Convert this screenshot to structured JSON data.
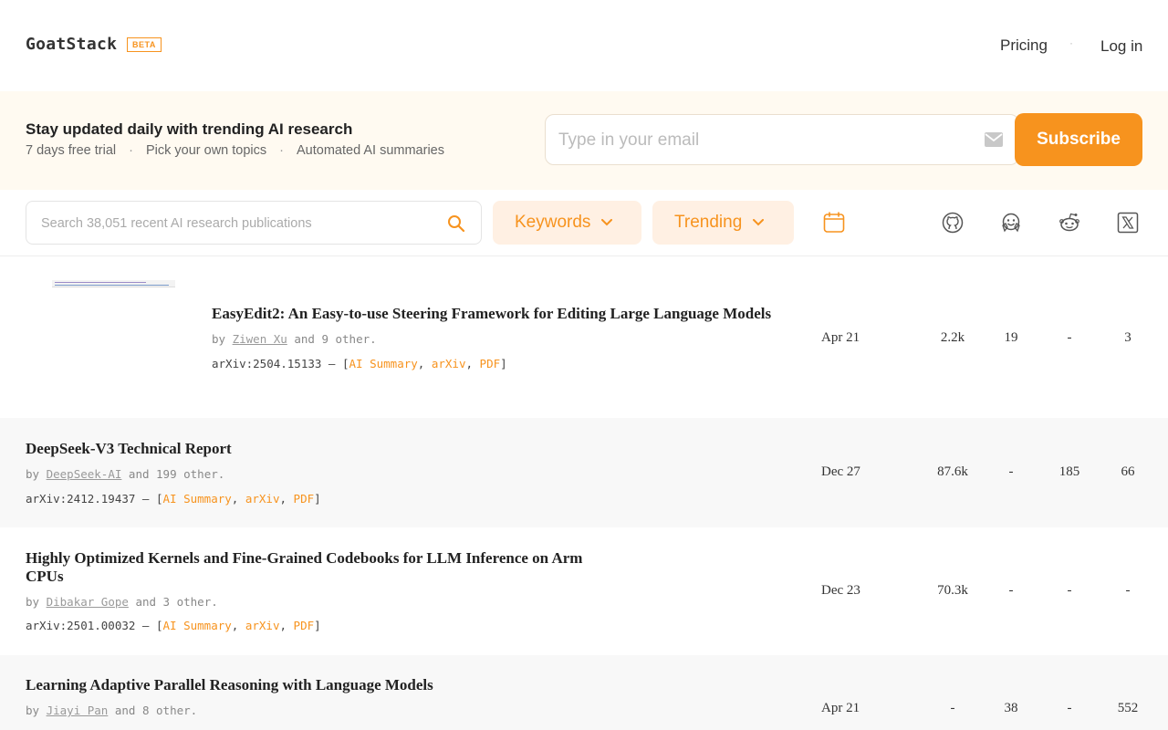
{
  "header": {
    "logo": "GoatStack",
    "beta": "BETA",
    "nav_pricing": "Pricing",
    "nav_separator": "·",
    "nav_login": "Log in"
  },
  "banner": {
    "title": "Stay updated daily with trending AI research",
    "features": [
      "7 days free trial",
      "Pick your own topics",
      "Automated AI summaries"
    ],
    "separator": "·",
    "email_placeholder": "Type in your email",
    "subscribe_label": "Subscribe"
  },
  "toolbar": {
    "search_placeholder": "Search 38,051 recent AI research publications",
    "keywords_label": "Keywords",
    "trending_label": "Trending",
    "source_icons": [
      "github-icon",
      "huggingface-icon",
      "reddit-icon",
      "x-icon"
    ]
  },
  "papers": [
    {
      "title": "EasyEdit2: An Easy-to-use Steering Framework for Editing Large Language Models",
      "by": "by",
      "author": "Ziwen Xu",
      "others": "and 9 other.",
      "arxiv_id": "arXiv:2504.15133 – [",
      "links": [
        "AI Summary",
        "arXiv",
        "PDF"
      ],
      "close": "]",
      "date": "Apr 21",
      "github": "2.2k",
      "huggingface": "19",
      "reddit": "-",
      "x": "3"
    },
    {
      "title": "DeepSeek-V3 Technical Report",
      "by": "by",
      "author": "DeepSeek-AI",
      "others": "and 199 other.",
      "arxiv_id": "arXiv:2412.19437 – [",
      "links": [
        "AI Summary",
        "arXiv",
        "PDF"
      ],
      "close": "]",
      "date": "Dec 27",
      "github": "87.6k",
      "huggingface": "-",
      "reddit": "185",
      "x": "66"
    },
    {
      "title": "Highly Optimized Kernels and Fine-Grained Codebooks for LLM Inference on Arm CPUs",
      "by": "by",
      "author": "Dibakar Gope",
      "others": "and 3 other.",
      "arxiv_id": "arXiv:2501.00032 – [",
      "links": [
        "AI Summary",
        "arXiv",
        "PDF"
      ],
      "close": "]",
      "date": "Dec 23",
      "github": "70.3k",
      "huggingface": "-",
      "reddit": "-",
      "x": "-"
    },
    {
      "title": "Learning Adaptive Parallel Reasoning with Language Models",
      "by": "by",
      "author": "Jiayi Pan",
      "others": "and 8 other.",
      "date": "Apr 21",
      "github": "-",
      "huggingface": "38",
      "reddit": "-",
      "x": "552"
    }
  ],
  "colors": {
    "accent": "#f7931e",
    "banner_bg": "#fffaf1",
    "pill_bg": "#fff0e3",
    "row_alt_bg": "#f8f8f8"
  }
}
